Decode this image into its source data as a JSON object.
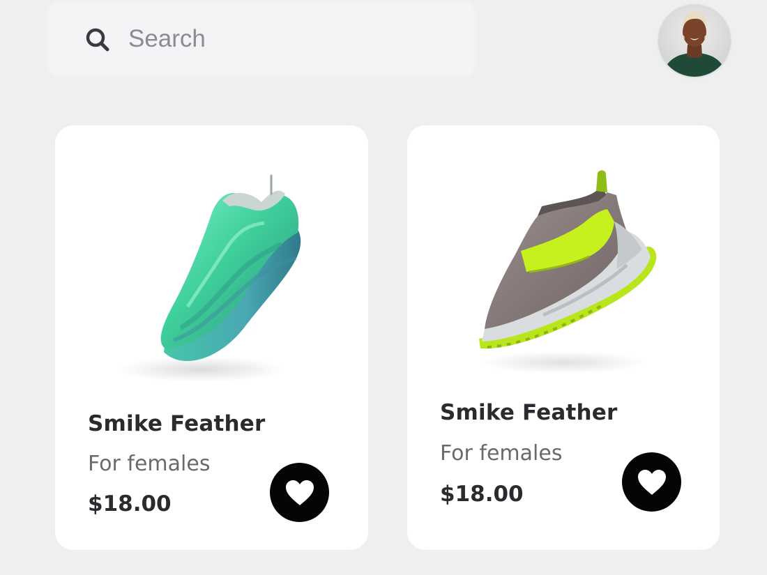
{
  "search": {
    "placeholder": "Search",
    "icon": "search-icon"
  },
  "user": {
    "avatar_icon": "user-avatar"
  },
  "products": [
    {
      "name": "Smike Feather",
      "subtitle": "For females",
      "price": "$18.00",
      "image": "mint-green-sneaker",
      "favorite_icon": "heart-icon"
    },
    {
      "name": "Smike Feather",
      "subtitle": "For females",
      "price": "$18.00",
      "image": "grey-lime-sneaker",
      "favorite_icon": "heart-icon"
    }
  ],
  "colors": {
    "background": "#eeeff1",
    "card": "#ffffff",
    "text_primary": "#2b2b2f",
    "text_secondary": "#6a6a6e",
    "favorite_button": "#050505",
    "shoe_1": "#4fd4a6",
    "shoe_2_accent": "#b8e61a"
  }
}
